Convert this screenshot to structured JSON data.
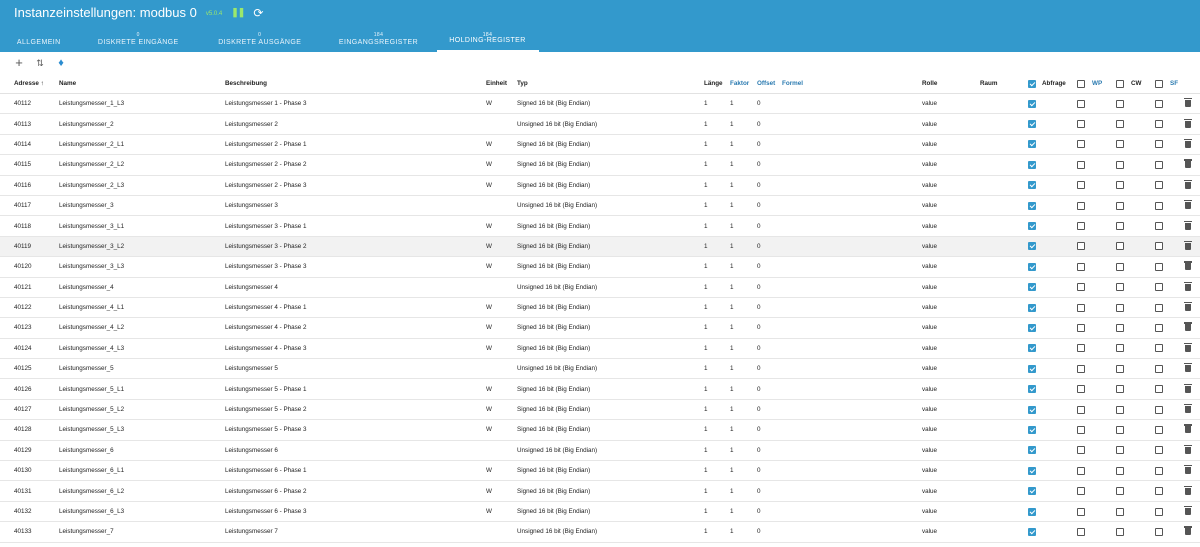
{
  "header": {
    "title": "Instanzeinstellungen: modbus 0",
    "version": "v5.0.4",
    "pause_icon": "pause-icon",
    "reload_icon": "reload-icon"
  },
  "tabs": [
    {
      "count": "",
      "label": "ALLGEMEIN"
    },
    {
      "count": "0",
      "label": "DISKRETE EINGÄNGE"
    },
    {
      "count": "0",
      "label": "DISKRETE AUSGÄNGE"
    },
    {
      "count": "184",
      "label": "EINGANGSREGISTER"
    },
    {
      "count": "184",
      "label": "HOLDING-REGISTER",
      "active": true
    }
  ],
  "toolbar": {
    "icons": [
      "add-icon",
      "sort-icon",
      "import-icon"
    ]
  },
  "columns": {
    "adresse": "Adresse ↑",
    "name": "Name",
    "beschreibung": "Beschreibung",
    "einheit": "Einheit",
    "typ": "Typ",
    "laenge": "Länge",
    "faktor": "Faktor",
    "offset": "Offset",
    "formel": "Formel",
    "rolle": "Rolle",
    "raum": "Raum",
    "abfrage": "Abfrage",
    "wp": "WP",
    "cw": "CW",
    "sf": "SF"
  },
  "header_checks": {
    "abfrage": true,
    "wp": false,
    "cw": false,
    "sf": false
  },
  "rows": [
    {
      "adresse": "40112",
      "name": "Leistungsmesser_1_L3",
      "beschreibung": "Leistungsmesser 1 - Phase 3",
      "einheit": "W",
      "typ": "Signed 16 bit (Big Endian)",
      "laenge": "1",
      "faktor": "1",
      "offset": "0",
      "rolle": "value",
      "abfrage": true,
      "wp": false,
      "cw": false,
      "sf": false
    },
    {
      "adresse": "40113",
      "name": "Leistungsmesser_2",
      "beschreibung": "Leistungsmesser 2",
      "einheit": "",
      "typ": "Unsigned 16 bit (Big Endian)",
      "laenge": "1",
      "faktor": "1",
      "offset": "0",
      "rolle": "value",
      "abfrage": true,
      "wp": false,
      "cw": false,
      "sf": false
    },
    {
      "adresse": "40114",
      "name": "Leistungsmesser_2_L1",
      "beschreibung": "Leistungsmesser 2 - Phase 1",
      "einheit": "W",
      "typ": "Signed 16 bit (Big Endian)",
      "laenge": "1",
      "faktor": "1",
      "offset": "0",
      "rolle": "value",
      "abfrage": true,
      "wp": false,
      "cw": false,
      "sf": false
    },
    {
      "adresse": "40115",
      "name": "Leistungsmesser_2_L2",
      "beschreibung": "Leistungsmesser 2 - Phase 2",
      "einheit": "W",
      "typ": "Signed 16 bit (Big Endian)",
      "laenge": "1",
      "faktor": "1",
      "offset": "0",
      "rolle": "value",
      "abfrage": true,
      "wp": false,
      "cw": false,
      "sf": false
    },
    {
      "adresse": "40116",
      "name": "Leistungsmesser_2_L3",
      "beschreibung": "Leistungsmesser 2 - Phase 3",
      "einheit": "W",
      "typ": "Signed 16 bit (Big Endian)",
      "laenge": "1",
      "faktor": "1",
      "offset": "0",
      "rolle": "value",
      "abfrage": true,
      "wp": false,
      "cw": false,
      "sf": false
    },
    {
      "adresse": "40117",
      "name": "Leistungsmesser_3",
      "beschreibung": "Leistungsmesser 3",
      "einheit": "",
      "typ": "Unsigned 16 bit (Big Endian)",
      "laenge": "1",
      "faktor": "1",
      "offset": "0",
      "rolle": "value",
      "abfrage": true,
      "wp": false,
      "cw": false,
      "sf": false
    },
    {
      "adresse": "40118",
      "name": "Leistungsmesser_3_L1",
      "beschreibung": "Leistungsmesser 3 - Phase 1",
      "einheit": "W",
      "typ": "Signed 16 bit (Big Endian)",
      "laenge": "1",
      "faktor": "1",
      "offset": "0",
      "rolle": "value",
      "abfrage": true,
      "wp": false,
      "cw": false,
      "sf": false
    },
    {
      "adresse": "40119",
      "name": "Leistungsmesser_3_L2",
      "beschreibung": "Leistungsmesser 3 - Phase 2",
      "einheit": "W",
      "typ": "Signed 16 bit (Big Endian)",
      "laenge": "1",
      "faktor": "1",
      "offset": "0",
      "rolle": "value",
      "abfrage": true,
      "wp": false,
      "cw": false,
      "sf": false,
      "highlight": true
    },
    {
      "adresse": "40120",
      "name": "Leistungsmesser_3_L3",
      "beschreibung": "Leistungsmesser 3 - Phase 3",
      "einheit": "W",
      "typ": "Signed 16 bit (Big Endian)",
      "laenge": "1",
      "faktor": "1",
      "offset": "0",
      "rolle": "value",
      "abfrage": true,
      "wp": false,
      "cw": false,
      "sf": false
    },
    {
      "adresse": "40121",
      "name": "Leistungsmesser_4",
      "beschreibung": "Leistungsmesser 4",
      "einheit": "",
      "typ": "Unsigned 16 bit (Big Endian)",
      "laenge": "1",
      "faktor": "1",
      "offset": "0",
      "rolle": "value",
      "abfrage": true,
      "wp": false,
      "cw": false,
      "sf": false
    },
    {
      "adresse": "40122",
      "name": "Leistungsmesser_4_L1",
      "beschreibung": "Leistungsmesser 4 - Phase 1",
      "einheit": "W",
      "typ": "Signed 16 bit (Big Endian)",
      "laenge": "1",
      "faktor": "1",
      "offset": "0",
      "rolle": "value",
      "abfrage": true,
      "wp": false,
      "cw": false,
      "sf": false
    },
    {
      "adresse": "40123",
      "name": "Leistungsmesser_4_L2",
      "beschreibung": "Leistungsmesser 4 - Phase 2",
      "einheit": "W",
      "typ": "Signed 16 bit (Big Endian)",
      "laenge": "1",
      "faktor": "1",
      "offset": "0",
      "rolle": "value",
      "abfrage": true,
      "wp": false,
      "cw": false,
      "sf": false
    },
    {
      "adresse": "40124",
      "name": "Leistungsmesser_4_L3",
      "beschreibung": "Leistungsmesser 4 - Phase 3",
      "einheit": "W",
      "typ": "Signed 16 bit (Big Endian)",
      "laenge": "1",
      "faktor": "1",
      "offset": "0",
      "rolle": "value",
      "abfrage": true,
      "wp": false,
      "cw": false,
      "sf": false
    },
    {
      "adresse": "40125",
      "name": "Leistungsmesser_5",
      "beschreibung": "Leistungsmesser 5",
      "einheit": "",
      "typ": "Unsigned 16 bit (Big Endian)",
      "laenge": "1",
      "faktor": "1",
      "offset": "0",
      "rolle": "value",
      "abfrage": true,
      "wp": false,
      "cw": false,
      "sf": false
    },
    {
      "adresse": "40126",
      "name": "Leistungsmesser_5_L1",
      "beschreibung": "Leistungsmesser 5 - Phase 1",
      "einheit": "W",
      "typ": "Signed 16 bit (Big Endian)",
      "laenge": "1",
      "faktor": "1",
      "offset": "0",
      "rolle": "value",
      "abfrage": true,
      "wp": false,
      "cw": false,
      "sf": false
    },
    {
      "adresse": "40127",
      "name": "Leistungsmesser_5_L2",
      "beschreibung": "Leistungsmesser 5 - Phase 2",
      "einheit": "W",
      "typ": "Signed 16 bit (Big Endian)",
      "laenge": "1",
      "faktor": "1",
      "offset": "0",
      "rolle": "value",
      "abfrage": true,
      "wp": false,
      "cw": false,
      "sf": false
    },
    {
      "adresse": "40128",
      "name": "Leistungsmesser_5_L3",
      "beschreibung": "Leistungsmesser 5 - Phase 3",
      "einheit": "W",
      "typ": "Signed 16 bit (Big Endian)",
      "laenge": "1",
      "faktor": "1",
      "offset": "0",
      "rolle": "value",
      "abfrage": true,
      "wp": false,
      "cw": false,
      "sf": false
    },
    {
      "adresse": "40129",
      "name": "Leistungsmesser_6",
      "beschreibung": "Leistungsmesser 6",
      "einheit": "",
      "typ": "Unsigned 16 bit (Big Endian)",
      "laenge": "1",
      "faktor": "1",
      "offset": "0",
      "rolle": "value",
      "abfrage": true,
      "wp": false,
      "cw": false,
      "sf": false
    },
    {
      "adresse": "40130",
      "name": "Leistungsmesser_6_L1",
      "beschreibung": "Leistungsmesser 6 - Phase 1",
      "einheit": "W",
      "typ": "Signed 16 bit (Big Endian)",
      "laenge": "1",
      "faktor": "1",
      "offset": "0",
      "rolle": "value",
      "abfrage": true,
      "wp": false,
      "cw": false,
      "sf": false
    },
    {
      "adresse": "40131",
      "name": "Leistungsmesser_6_L2",
      "beschreibung": "Leistungsmesser 6 - Phase 2",
      "einheit": "W",
      "typ": "Signed 16 bit (Big Endian)",
      "laenge": "1",
      "faktor": "1",
      "offset": "0",
      "rolle": "value",
      "abfrage": true,
      "wp": false,
      "cw": false,
      "sf": false
    },
    {
      "adresse": "40132",
      "name": "Leistungsmesser_6_L3",
      "beschreibung": "Leistungsmesser 6 - Phase 3",
      "einheit": "W",
      "typ": "Signed 16 bit (Big Endian)",
      "laenge": "1",
      "faktor": "1",
      "offset": "0",
      "rolle": "value",
      "abfrage": true,
      "wp": false,
      "cw": false,
      "sf": false
    },
    {
      "adresse": "40133",
      "name": "Leistungsmesser_7",
      "beschreibung": "Leistungsmesser 7",
      "einheit": "",
      "typ": "Unsigned 16 bit (Big Endian)",
      "laenge": "1",
      "faktor": "1",
      "offset": "0",
      "rolle": "value",
      "abfrage": true,
      "wp": false,
      "cw": false,
      "sf": false
    }
  ]
}
